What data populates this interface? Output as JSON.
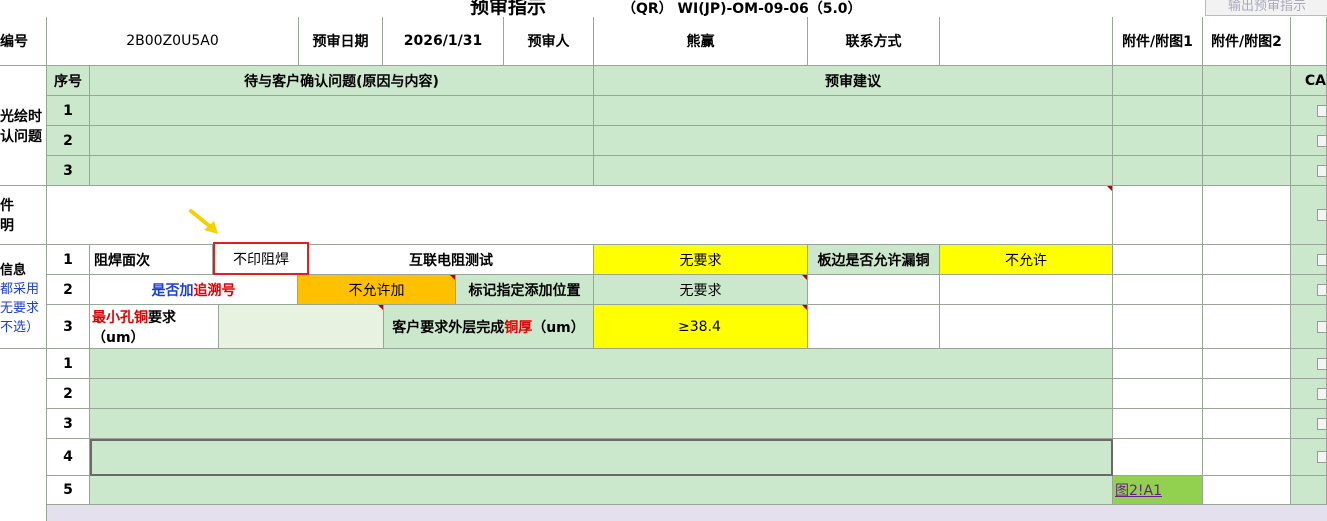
{
  "title": {
    "main": "预审指示",
    "code": "（QR） WI(JP)-OM-09-06（5.0）"
  },
  "export_button": "输出预审指示",
  "header": {
    "code_label": "编号",
    "code_value": "2B00Z0U5A0",
    "date_label": "预审日期",
    "date_value": "2026/1/31",
    "reviewer_label": "预审人",
    "reviewer_value": "熊赢",
    "contact_label": "联系方式",
    "contact_value": "",
    "attach1": "附件/附图1",
    "attach2": "附件/附图2"
  },
  "q_section": {
    "side_label": [
      "光绘时",
      "认问题"
    ],
    "seq_label": "序号",
    "issue_label": "待与客户确认问题(原因与内容)",
    "suggest_label": "预审建议",
    "rows": [
      "1",
      "2",
      "3"
    ],
    "far_col_label": "CA"
  },
  "note_section": {
    "side_label": [
      "件",
      "明"
    ]
  },
  "info_section": {
    "side_label": [
      "信息",
      "都采用",
      "无要求",
      "不选）"
    ],
    "rows": [
      {
        "no": "1",
        "label": "阻焊面次",
        "value": "不印阻焊",
        "test_label": "互联电阻测试",
        "test_value": "无要求",
        "edge_label": "板边是否允许漏铜",
        "edge_value": "不允许"
      },
      {
        "no": "2",
        "trace_prefix": "是否加",
        "trace_suffix": "追溯号",
        "trace_value": "不允许加",
        "mark_label": "标记指定添加位置",
        "mark_value": "无要求"
      },
      {
        "no": "3",
        "hole_prefix": "最小孔铜",
        "hole_suffix": "要求",
        "hole_unit": "（um）",
        "hole_value": "",
        "thick_prefix": "客户要求外层完成",
        "thick_red": "铜厚",
        "thick_unit": "（um）",
        "thick_value": "≥38.4"
      }
    ]
  },
  "extra_rows": [
    "1",
    "2",
    "3",
    "4",
    "5"
  ],
  "link_text": "图2!A1"
}
